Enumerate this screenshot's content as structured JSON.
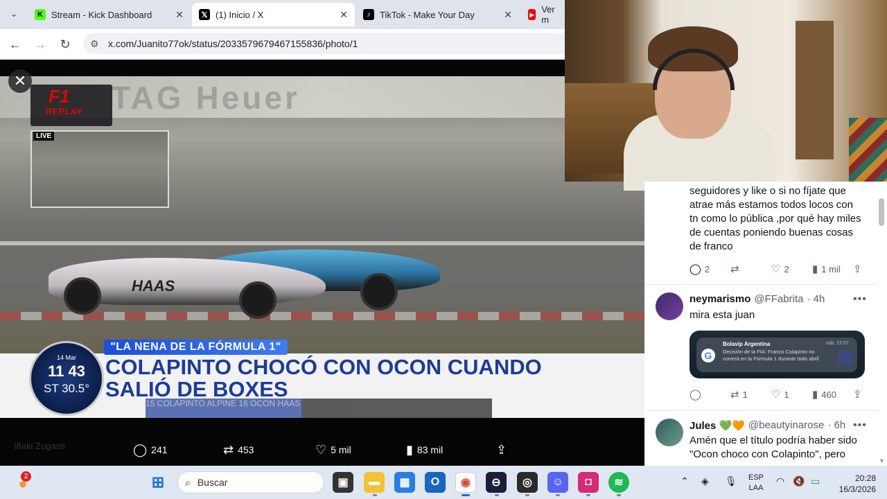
{
  "browser": {
    "tabs": [
      {
        "title": "Stream - Kick Dashboard",
        "favicon": "kick-icon",
        "color": "#53fc18"
      },
      {
        "title": "(1) Inicio / X",
        "favicon": "x-icon",
        "color": "#000000"
      },
      {
        "title": "TikTok - Make Your Day",
        "favicon": "tiktok-icon",
        "color": "#000000"
      },
      {
        "title": "Ver m",
        "favicon": "youtube-icon",
        "color": "#ff0000"
      }
    ],
    "url": "x.com/Juanito77ok/status/2033579679467155836/photo/1"
  },
  "video": {
    "f1_replay": "REPLAY",
    "live_label": "LIVE",
    "car_livery": "HAAS",
    "tag": "\"LA NENA DE LA FÓRMULA 1\"",
    "headline": "COLAPINTO CHOCÓ CON OCON CUANDO SALIÓ DE BOXES",
    "clock_date": "14 Mar",
    "clock_time": "11 43",
    "clock_temp": "ST 30.5°",
    "positions": "15 COLAPINTO  ALPINE      16 OCON  HAAS"
  },
  "post_stats": {
    "replies": "241",
    "reposts": "453",
    "likes": "5 mil",
    "views": "83 mil"
  },
  "ghost_author": "Iñaki Zugasti",
  "thread": {
    "reply1": {
      "text": "seguidores y like o si no fíjate que atrae más estamos todos locos con tn como lo pública ,por qué hay miles de cuentas poniendo buenas cosas de franco",
      "replies": "2",
      "reposts": "",
      "likes": "2",
      "views": "1 mil"
    },
    "reply2": {
      "name": "neymarismo",
      "handle": "@FFabrita",
      "time": "· 4h",
      "text": "mira esta juan",
      "embed": {
        "source": "Bolavip Argentina",
        "time": "sáb. 22:57",
        "body": "Decisión de la FIA: Franco Colapinto no correrá en la Fórmula 1 durante todo abril"
      },
      "replies": "",
      "reposts": "1",
      "likes": "1",
      "views": "460"
    },
    "reply3": {
      "name": "Jules 💚🧡",
      "handle": "@beautyinarose",
      "time": "· 6h",
      "text": "Amén que el título podría haber sido \"Ocon choco con Colapinto\", pero"
    }
  },
  "taskbar": {
    "search": "Buscar",
    "notification_count": "2",
    "lang_top": "ESP",
    "lang_bottom": "LAA",
    "time": "20:28",
    "date": "16/3/2026"
  }
}
